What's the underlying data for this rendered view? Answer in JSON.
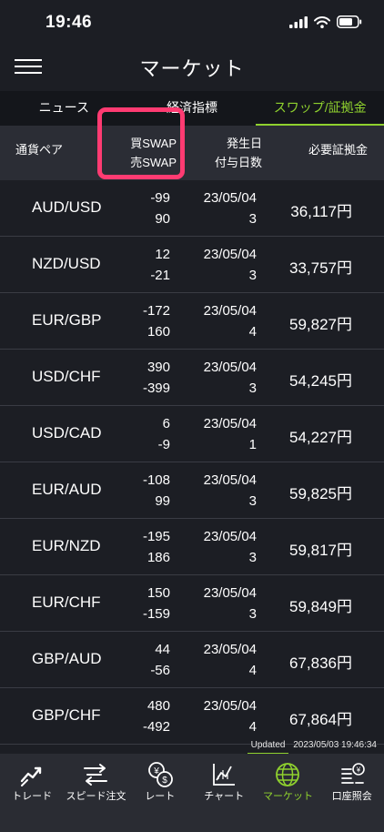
{
  "status_bar": {
    "time": "19:46"
  },
  "header": {
    "title": "マーケット",
    "menu_icon": "hamburger-menu-icon"
  },
  "tabs": [
    {
      "label": "ニュース",
      "active": false
    },
    {
      "label": "経済指標",
      "active": false
    },
    {
      "label": "スワップ/証拠金",
      "active": true
    }
  ],
  "columns": {
    "pair": "通貨ペア",
    "buy_swap": "買SWAP",
    "sell_swap": "売SWAP",
    "date": "発生日",
    "days": "付与日数",
    "margin": "必要証拠金"
  },
  "rows": [
    {
      "pair": "AUD/USD",
      "buy": "-99",
      "sell": "90",
      "date": "23/05/04",
      "days": "3",
      "margin": "36,117円"
    },
    {
      "pair": "NZD/USD",
      "buy": "12",
      "sell": "-21",
      "date": "23/05/04",
      "days": "3",
      "margin": "33,757円"
    },
    {
      "pair": "EUR/GBP",
      "buy": "-172",
      "sell": "160",
      "date": "23/05/04",
      "days": "4",
      "margin": "59,827円"
    },
    {
      "pair": "USD/CHF",
      "buy": "390",
      "sell": "-399",
      "date": "23/05/04",
      "days": "3",
      "margin": "54,245円"
    },
    {
      "pair": "USD/CAD",
      "buy": "6",
      "sell": "-9",
      "date": "23/05/04",
      "days": "1",
      "margin": "54,227円"
    },
    {
      "pair": "EUR/AUD",
      "buy": "-108",
      "sell": "99",
      "date": "23/05/04",
      "days": "3",
      "margin": "59,825円"
    },
    {
      "pair": "EUR/NZD",
      "buy": "-195",
      "sell": "186",
      "date": "23/05/04",
      "days": "3",
      "margin": "59,817円"
    },
    {
      "pair": "EUR/CHF",
      "buy": "150",
      "sell": "-159",
      "date": "23/05/04",
      "days": "3",
      "margin": "59,849円"
    },
    {
      "pair": "GBP/AUD",
      "buy": "44",
      "sell": "-56",
      "date": "23/05/04",
      "days": "4",
      "margin": "67,836円"
    },
    {
      "pair": "GBP/CHF",
      "buy": "480",
      "sell": "-492",
      "date": "23/05/04",
      "days": "4",
      "margin": "67,864円"
    }
  ],
  "updated": {
    "label": "Updated",
    "timestamp": "2023/05/03 19:46:34"
  },
  "bottom_nav": [
    {
      "label": "トレード",
      "icon": "trade-chart-icon",
      "active": false
    },
    {
      "label": "スピード注文",
      "icon": "speed-order-icon",
      "active": false
    },
    {
      "label": "レート",
      "icon": "rate-currency-icon",
      "active": false
    },
    {
      "label": "チャート",
      "icon": "chart-icon",
      "active": false
    },
    {
      "label": "マーケット",
      "icon": "globe-icon",
      "active": true
    },
    {
      "label": "口座照会",
      "icon": "account-inquiry-icon",
      "active": false
    }
  ],
  "colors": {
    "accent": "#8fd12e",
    "highlight": "#ff3b72",
    "background": "#1c1e24"
  }
}
